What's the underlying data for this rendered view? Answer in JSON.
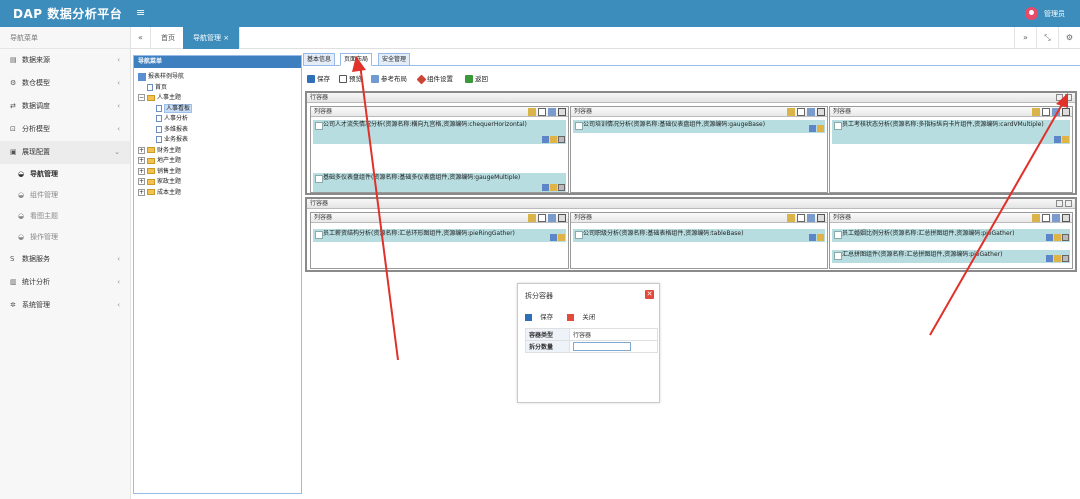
{
  "app": {
    "title": "DAP 数据分析平台",
    "user_name": "管理员"
  },
  "sidebar": {
    "header": "导航菜单",
    "items": [
      {
        "label": "数据来源",
        "icon": "database-icon"
      },
      {
        "label": "数仓模型",
        "icon": "model-icon"
      },
      {
        "label": "数据调度",
        "icon": "shuffle-icon"
      },
      {
        "label": "分析模型",
        "icon": "chart-model-icon"
      },
      {
        "label": "展现配置",
        "icon": "display-config-icon"
      },
      {
        "label": "数据服务",
        "icon": "dollar-icon"
      },
      {
        "label": "统计分析",
        "icon": "bar-chart-icon"
      },
      {
        "label": "系统管理",
        "icon": "gear-icon"
      }
    ],
    "sub_items": [
      "导航管理",
      "组件管理",
      "看图主题",
      "操作管理"
    ]
  },
  "tabbar": {
    "home": "首页",
    "active": "导航管理"
  },
  "nav_panel": {
    "title": "导航菜单",
    "tree": [
      "报表样例导航",
      "首页",
      "人事主题",
      "人事看板",
      "人事分析",
      "多维报表",
      "业务报表",
      "财务主题",
      "地产主题",
      "销售主题",
      "家政主题",
      "成本主题"
    ]
  },
  "main_tabs": [
    "基本信息",
    "页面布局",
    "安全管理"
  ],
  "toolbar": {
    "save": "保存",
    "preview": "预览",
    "ref_layout": "参考布局",
    "widget_settings": "组件设置",
    "back": "返回"
  },
  "layout": {
    "row_label": "行容器",
    "col_label": "列容器",
    "components": [
      "公司人才流失情况分析(资源名称:横向九宫格,资源编码:chequerHorizontal)",
      "公司培训情况分析(资源名称:基础仪表盘组件,资源编码:gaugeBase)",
      "员工考核状态分析(资源名称:多指标纵向卡片组件,资源编码:cardVMultiple)",
      "基础多仪表盘组件(资源名称:基础多仪表盘组件,资源编码:gaugeMultiple)",
      "员工薪资结构分析(资源名称:汇总环形图组件,资源编码:pieRingGather)",
      "公司职级分析(资源名称:基础表格组件,资源编码:tableBase)",
      "员工婚姻比例分析(资源名称:汇总拼图组件,资源编码:pieGather)",
      "汇总拼图组件(资源名称:汇总拼图组件,资源编码:pieGather)"
    ]
  },
  "dialog": {
    "title": "拆分容器",
    "save": "保存",
    "close": "关闭",
    "type_label": "容器类型",
    "type_value": "行容器",
    "split_label": "拆分数量",
    "split_value": ""
  }
}
